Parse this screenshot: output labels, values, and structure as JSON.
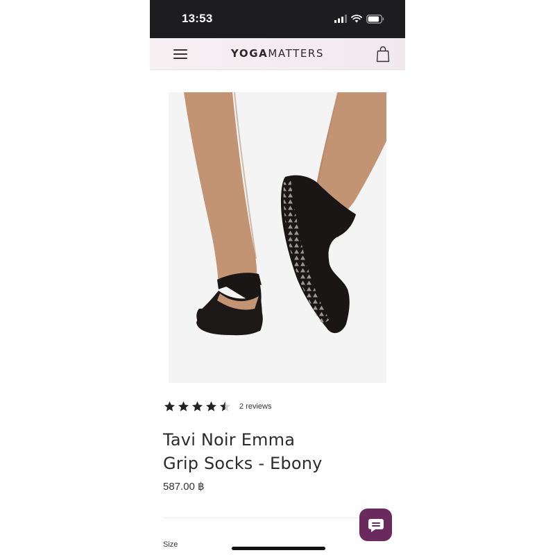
{
  "status_bar": {
    "time": "13:53"
  },
  "header": {
    "logo_bold": "YOGA",
    "logo_light": "MATTERS"
  },
  "product": {
    "rating_value": 4.5,
    "rating_max": 5,
    "reviews_text": "2 reviews",
    "title_line1": "Tavi Noir Emma",
    "title_line2": "Grip Socks - Ebony",
    "price": "587.00 ฿"
  },
  "options": {
    "size_label": "Size"
  },
  "icons": {
    "menu": "hamburger-icon",
    "bag": "shopping-bag-icon",
    "star": "star-icon",
    "chat": "chat-bubble-icon"
  },
  "colors": {
    "chat_button": "#6a2a5d",
    "status_bar": "#1d1d1f",
    "header_bg": "#f4edf1"
  }
}
